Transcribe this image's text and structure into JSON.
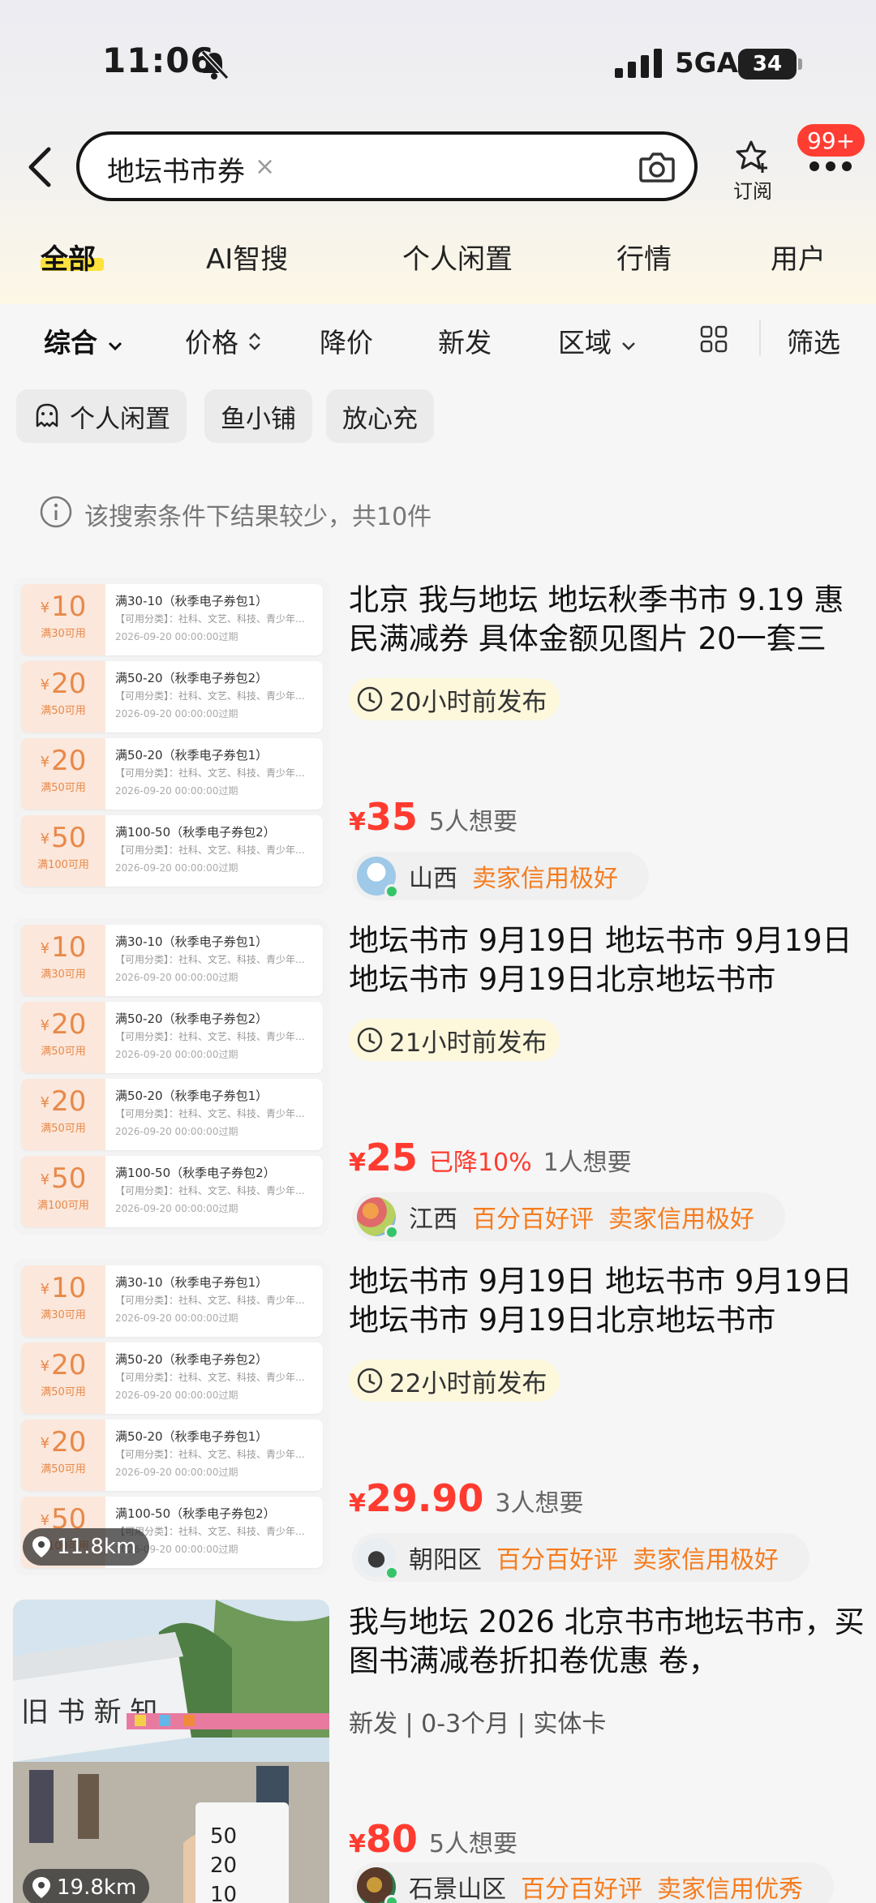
{
  "status_bar": {
    "time": "11:06",
    "network": "5GA",
    "battery": "34"
  },
  "search": {
    "query": "地坛书市券",
    "clear": "×"
  },
  "header": {
    "subscribe_label": "订阅",
    "badge": "99+"
  },
  "tabs": [
    {
      "label": "全部",
      "active": true
    },
    {
      "label": "AI智搜"
    },
    {
      "label": "个人闲置"
    },
    {
      "label": "行情"
    },
    {
      "label": "用户"
    }
  ],
  "sort": {
    "composite": "综合",
    "price": "价格",
    "price_drop": "降价",
    "new": "新发",
    "region": "区域",
    "filter": "筛选"
  },
  "chips": [
    "个人闲置",
    "鱼小铺",
    "放心充"
  ],
  "notice": "该搜索条件下结果较少，共10件",
  "coupons": [
    {
      "currency": "¥",
      "amount": "10",
      "condition": "满30可用",
      "title": "满30-10（秋季电子券包1）",
      "line2": "【可用分类】：社科、文艺、科技、青少年…",
      "line3": "2026-09-20 00:00:00过期"
    },
    {
      "currency": "¥",
      "amount": "20",
      "condition": "满50可用",
      "title": "满50-20（秋季电子券包2）",
      "line2": "【可用分类】：社科、文艺、科技、青少年…",
      "line3": "2026-09-20 00:00:00过期"
    },
    {
      "currency": "¥",
      "amount": "20",
      "condition": "满50可用",
      "title": "满50-20（秋季电子券包1）",
      "line2": "【可用分类】：社科、文艺、科技、青少年…",
      "line3": "2026-09-20 00:00:00过期"
    },
    {
      "currency": "¥",
      "amount": "50",
      "condition": "满100可用",
      "title": "满100-50（秋季电子券包2）",
      "line2": "【可用分类】：社科、文艺、科技、青少年…",
      "line3": "2026-09-20 00:00:00过期"
    }
  ],
  "items": [
    {
      "title": "北京 我与地坛 地坛秋季书市 9.19 惠民满减券 具体金额见图片 20一套三",
      "time": "20小时前发布",
      "currency": "¥",
      "price": "35",
      "wants": "5人想要",
      "region": "山西",
      "credit1": "卖家信用极好"
    },
    {
      "title": "地坛书市 9月19日 地坛书市 9月19日地坛书市 9月19日北京地坛书市",
      "time": "21小时前发布",
      "currency": "¥",
      "price": "25",
      "drop": "已降10%",
      "wants": "1人想要",
      "region": "江西",
      "credit1": "百分百好评",
      "credit2": "卖家信用极好"
    },
    {
      "title": "地坛书市 9月19日 地坛书市 9月19日地坛书市 9月19日北京地坛书市",
      "time": "22小时前发布",
      "currency": "¥",
      "price": "29.90",
      "wants": "3人想要",
      "region": "朝阳区",
      "credit1": "百分百好评",
      "credit2": "卖家信用极好",
      "distance": "11.8km"
    },
    {
      "title": "我与地坛 2026 北京书市地坛书市，买图书满减卷折扣卷优惠 卷，",
      "tags": "新发 | 0-3个月 | 实体卡",
      "currency": "¥",
      "price": "80",
      "wants": "5人想要",
      "region": "石景山区",
      "credit1": "百分百好评",
      "credit2": "卖家信用优秀",
      "distance": "19.8km",
      "photo_sign": "旧 书 新 知",
      "photo_values": [
        "50",
        "20",
        "10"
      ]
    }
  ]
}
